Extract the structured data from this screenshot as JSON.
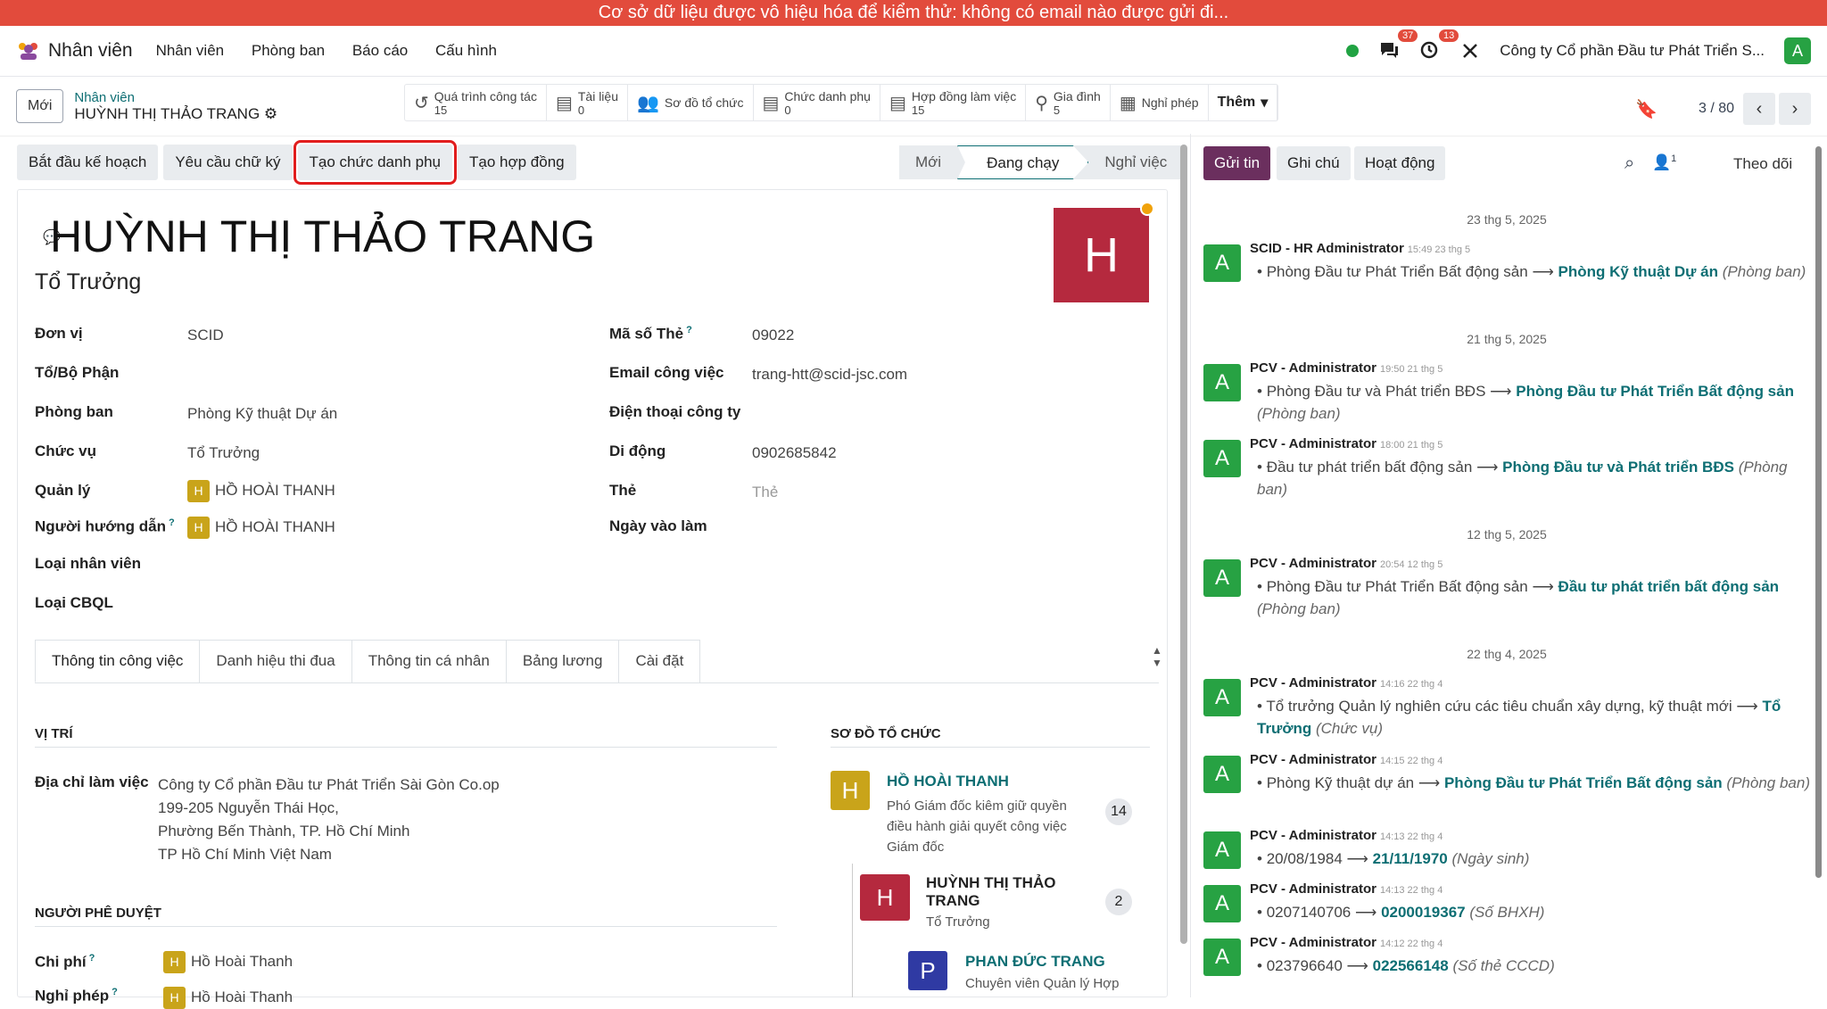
{
  "banner": "Cơ sở dữ liệu được vô hiệu hóa để kiểm thử: không có email nào được gửi đi...",
  "nav": {
    "app": "Nhân viên",
    "menu": [
      "Nhân viên",
      "Phòng ban",
      "Báo cáo",
      "Cấu hình"
    ],
    "msg_count": "37",
    "activity_count": "13",
    "company": "Công ty Cổ phần Đầu tư Phát Triển S...",
    "user_initial": "A"
  },
  "control": {
    "new": "Mới",
    "breadcrumb_parent": "Nhân viên",
    "breadcrumb_current": "HUỲNH THỊ THẢO TRANG",
    "pager": "3 / 80",
    "more": "Thêm"
  },
  "stats": [
    {
      "label": "Quá trình công tác",
      "num": "15"
    },
    {
      "label": "Tài liệu",
      "num": "0"
    },
    {
      "label": "Sơ đồ tổ chức",
      "num": ""
    },
    {
      "label": "Chức danh phụ",
      "num": "0"
    },
    {
      "label": "Hợp đồng làm việc",
      "num": "15"
    },
    {
      "label": "Gia đình",
      "num": "5"
    },
    {
      "label": "Nghỉ phép",
      "num": ""
    }
  ],
  "actions": [
    "Bắt đầu kế hoạch",
    "Yêu cầu chữ ký",
    "Tạo chức danh phụ",
    "Tạo hợp đồng"
  ],
  "status": [
    "Mới",
    "Đang chạy",
    "Nghỉ việc"
  ],
  "employee": {
    "name": "HUỲNH THỊ THẢO TRANG",
    "job": "Tổ Trưởng",
    "initial": "H"
  },
  "fields_left": [
    {
      "label": "Đơn vị",
      "value": "SCID"
    },
    {
      "label": "Tổ/Bộ Phận",
      "value": ""
    },
    {
      "label": "Phòng ban",
      "value": "Phòng Kỹ thuật Dự án"
    },
    {
      "label": "Chức vụ",
      "value": "Tổ Trưởng"
    },
    {
      "label": "Quản lý",
      "value": "HỒ HOÀI THANH"
    },
    {
      "label": "Người hướng dẫn",
      "value": "HỒ HOÀI THANH"
    },
    {
      "label": "Loại nhân viên",
      "value": ""
    },
    {
      "label": "Loại CBQL",
      "value": ""
    }
  ],
  "fields_right": [
    {
      "label": "Mã số Thẻ",
      "value": "09022"
    },
    {
      "label": "Email công việc",
      "value": "trang-htt@scid-jsc.com"
    },
    {
      "label": "Điện thoại công ty",
      "value": ""
    },
    {
      "label": "Di động",
      "value": "0902685842"
    },
    {
      "label": "Thẻ",
      "value": "Thẻ"
    },
    {
      "label": "Ngày vào làm",
      "value": ""
    }
  ],
  "tabs": [
    "Thông tin công việc",
    "Danh hiệu thi đua",
    "Thông tin cá nhân",
    "Bảng lương",
    "Cài đặt"
  ],
  "work": {
    "pos_title": "VỊ TRÍ",
    "addr_label": "Địa chỉ làm việc",
    "addr": [
      "Công ty Cổ phần Đầu tư Phát Triển Sài Gòn Co.op",
      "199-205 Nguyễn Thái Học,",
      "Phường Bến Thành, TP. Hồ Chí Minh",
      "TP Hồ Chí Minh Việt Nam"
    ],
    "approver_title": "NGƯỜI PHÊ DUYỆT",
    "cost_label": "Chi phí",
    "cost_val": "Hồ Hoài Thanh",
    "leave_label": "Nghỉ phép",
    "leave_val": "Hồ Hoài Thanh"
  },
  "org": {
    "title": "SƠ ĐỒ TỔ CHỨC",
    "p1_name": "HỒ HOÀI THANH",
    "p1_desc": "Phó Giám đốc kiêm giữ quyền điều hành giải quyết công việc Giám đốc",
    "p1_count": "14",
    "p2_name": "HUỲNH THỊ THẢO TRANG",
    "p2_job": "Tổ Trưởng",
    "p2_count": "2",
    "p3_name": "PHAN ĐỨC TRANG",
    "p3_job": "Chuyên viên Quản lý Hợp"
  },
  "chatter": {
    "send": "Gửi tin",
    "note": "Ghi chú",
    "activity": "Hoạt động",
    "followers": "1",
    "follow": "Theo dõi",
    "messages": [
      {
        "date": "23 thg 5, 2025",
        "who": "SCID - HR Administrator",
        "time": "15:49 23 thg 5",
        "old": "Phòng Đầu tư Phát Triển Bất động sản",
        "new": "Phòng Kỹ thuật Dự án",
        "field": "(Phòng ban)"
      },
      {
        "date": "21 thg 5, 2025",
        "who": "PCV - Administrator",
        "time": "19:50 21 thg 5",
        "old": "Phòng Đầu tư và Phát triển BĐS",
        "new": "Phòng Đầu tư Phát Triển Bất động sản",
        "field": "(Phòng ban)"
      },
      {
        "date": "",
        "who": "PCV - Administrator",
        "time": "18:00 21 thg 5",
        "old": "Đầu tư phát triển bất động sản",
        "new": "Phòng Đầu tư và Phát triển BĐS",
        "field": "(Phòng ban)"
      },
      {
        "date": "12 thg 5, 2025",
        "who": "PCV - Administrator",
        "time": "20:54 12 thg 5",
        "old": "Phòng Đầu tư Phát Triển Bất động sản",
        "new": "Đầu tư phát triển bất động sản",
        "field": "(Phòng ban)"
      },
      {
        "date": "22 thg 4, 2025",
        "who": "PCV - Administrator",
        "time": "14:16 22 thg 4",
        "old": "Tổ trưởng Quản lý nghiên cứu các tiêu chuẩn xây dựng, kỹ thuật mới",
        "new": "Tổ Trưởng",
        "field": "(Chức vụ)"
      },
      {
        "date": "",
        "who": "PCV - Administrator",
        "time": "14:15 22 thg 4",
        "old": "Phòng Kỹ thuật dự án",
        "new": "Phòng Đầu tư Phát Triển Bất động sản",
        "field": "(Phòng ban)"
      },
      {
        "date": "",
        "who": "PCV - Administrator",
        "time": "14:13 22 thg 4",
        "old": "20/08/1984",
        "new": "21/11/1970",
        "field": "(Ngày sinh)"
      },
      {
        "date": "",
        "who": "PCV - Administrator",
        "time": "14:13 22 thg 4",
        "old": "0207140706",
        "new": "0200019367",
        "field": "(Số BHXH)"
      },
      {
        "date": "",
        "who": "PCV - Administrator",
        "time": "14:12 22 thg 4",
        "old": "023796640",
        "new": "022566148",
        "field": "(Số thẻ CCCD)"
      }
    ]
  }
}
